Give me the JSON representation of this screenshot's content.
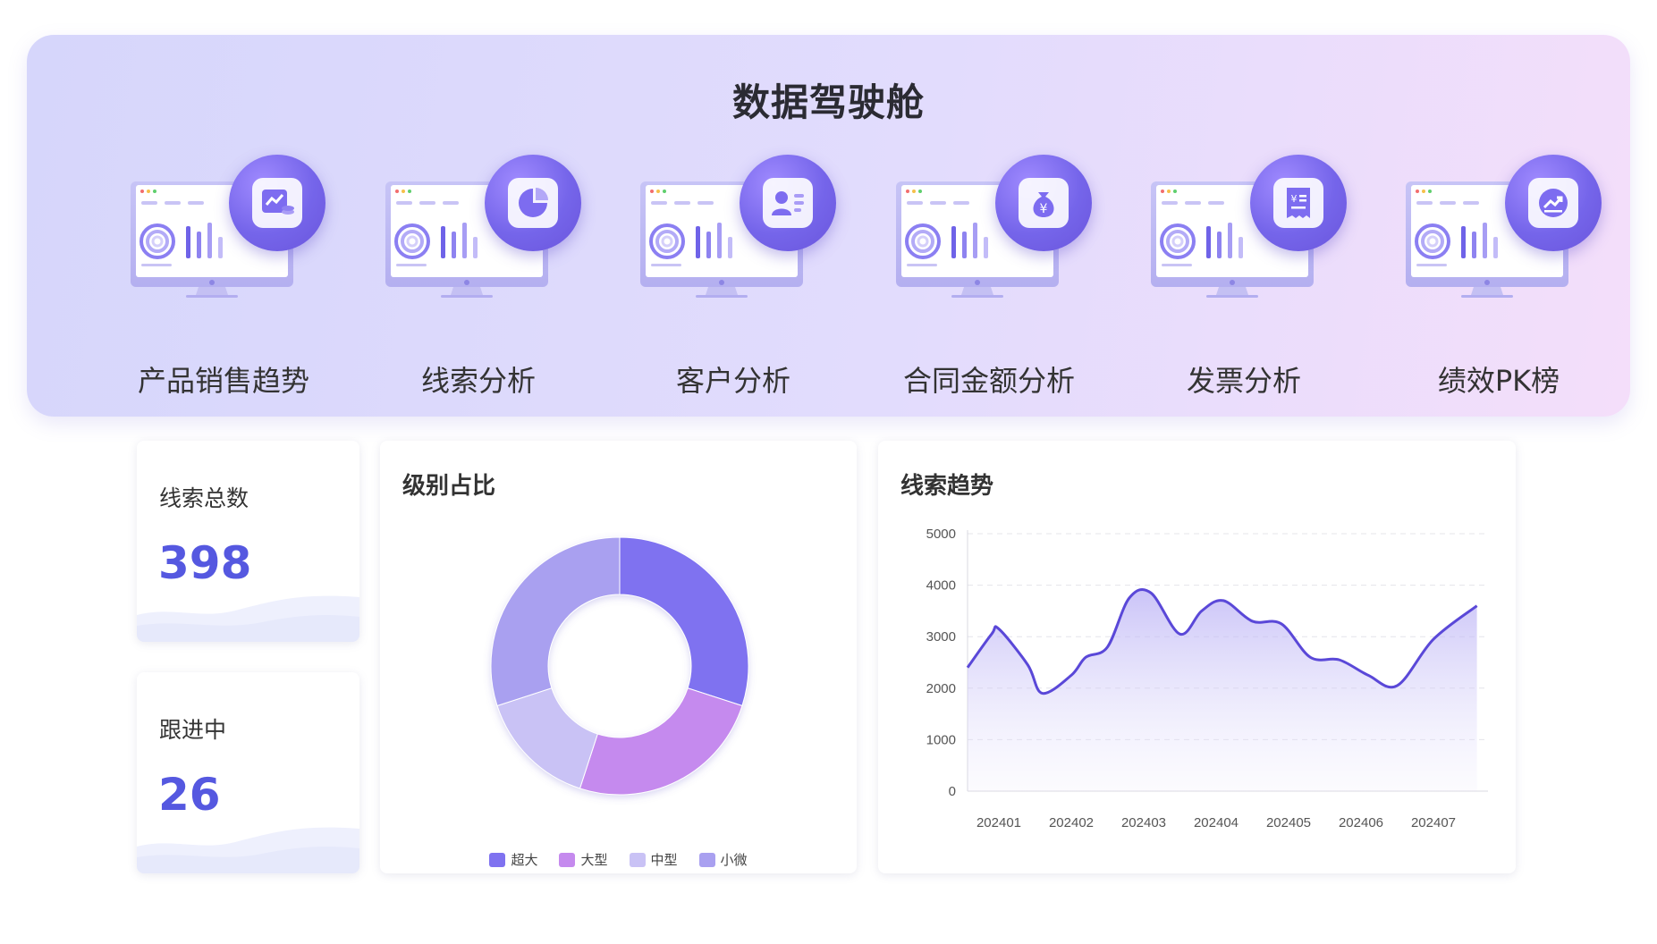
{
  "cockpit": {
    "title": "数据驾驶舱",
    "modules": [
      {
        "label": "产品销售趋势",
        "icon": "sales-trend-icon"
      },
      {
        "label": "线索分析",
        "icon": "pie-chart-icon"
      },
      {
        "label": "客户分析",
        "icon": "customer-card-icon"
      },
      {
        "label": "合同金额分析",
        "icon": "money-bag-icon"
      },
      {
        "label": "发票分析",
        "icon": "invoice-icon"
      },
      {
        "label": "绩效PK榜",
        "icon": "growth-arrow-icon"
      }
    ]
  },
  "stats": {
    "total_leads": {
      "label": "线索总数",
      "value": "398"
    },
    "in_progress": {
      "label": "跟进中",
      "value": "26"
    }
  },
  "level_chart": {
    "title": "级别占比",
    "chart_data": {
      "type": "pie",
      "style": "donut",
      "categories": [
        "超大",
        "大型",
        "中型",
        "小微"
      ],
      "values": [
        30,
        25,
        15,
        30
      ],
      "colors": [
        "#7f72f0",
        "#c58aee",
        "#c9c2f5",
        "#a9a0f0"
      ],
      "legend_position": "bottom"
    }
  },
  "trend_chart": {
    "title": "线索趋势",
    "chart_data": {
      "type": "area",
      "x": [
        "202401",
        "202402",
        "202403",
        "202404",
        "202405",
        "202406",
        "202407"
      ],
      "y_ticks": [
        0,
        1000,
        2000,
        3000,
        4000,
        5000
      ],
      "ylim": [
        0,
        5000
      ],
      "grid": true,
      "line_color": "#5a48d8",
      "series": [
        {
          "x_points": [
            0.0,
            0.4,
            0.5,
            0.9,
            1.1,
            1.5,
            1.7,
            2.0,
            2.3,
            2.6,
            3.0,
            3.3,
            3.6,
            4.0,
            4.4,
            4.8,
            5.2,
            5.6,
            6.0,
            6.5,
            7.1
          ],
          "y_points": [
            2400,
            3050,
            3150,
            2450,
            1900,
            2250,
            2600,
            2800,
            3750,
            3850,
            3050,
            3500,
            3700,
            3300,
            3250,
            2600,
            2550,
            2250,
            2050,
            2950,
            3600
          ]
        }
      ]
    }
  },
  "colors": {
    "accent": "#5558e0",
    "banner_start": "#d6d6fb",
    "banner_end": "#f4defa"
  }
}
